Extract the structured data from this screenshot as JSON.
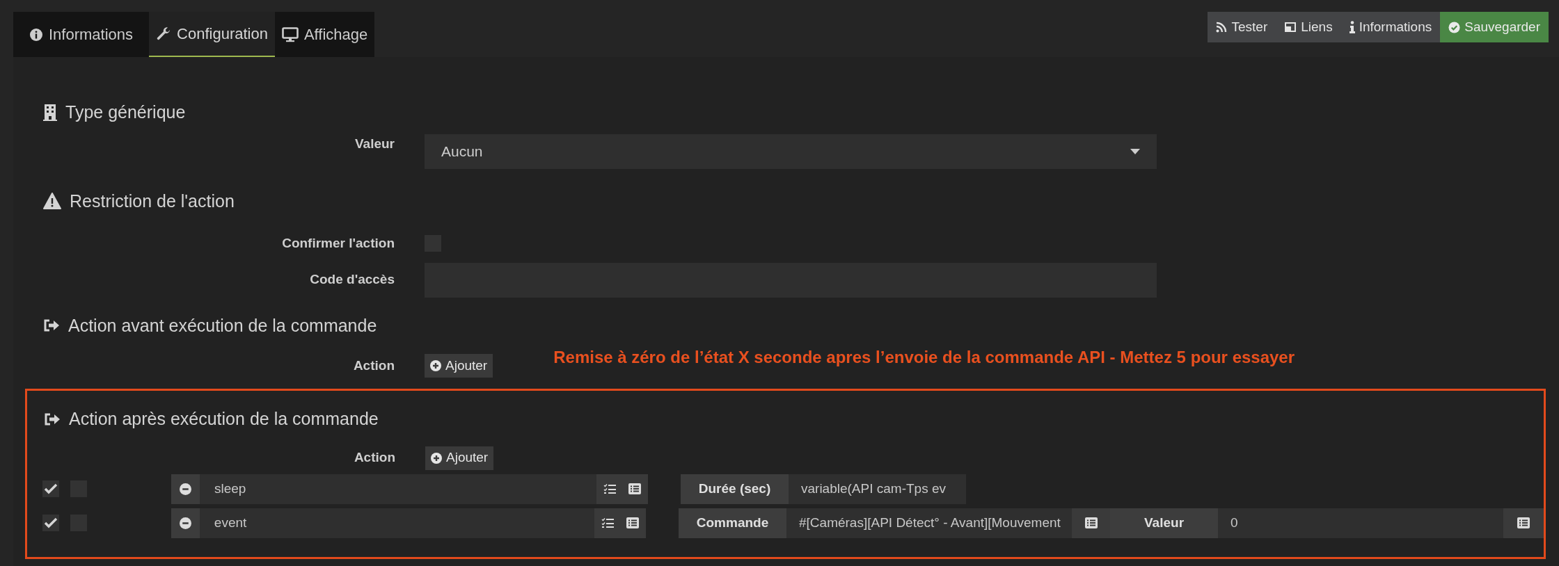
{
  "tabs": [
    {
      "label": "Informations",
      "selected": false
    },
    {
      "label": "Configuration",
      "selected": true
    },
    {
      "label": "Affichage",
      "selected": false
    }
  ],
  "toolbar": [
    {
      "label": "Tester",
      "kind": "default"
    },
    {
      "label": "Liens",
      "kind": "default"
    },
    {
      "label": "Informations",
      "kind": "default"
    },
    {
      "label": "Sauvegarder",
      "kind": "success"
    }
  ],
  "generic_type": {
    "title": "Type générique",
    "label": "Valeur",
    "value": "Aucun"
  },
  "restriction": {
    "title": "Restriction de l'action",
    "confirm_label": "Confirmer l'action",
    "confirm_checked": false,
    "code_label": "Code d'accès"
  },
  "pre_action": {
    "title": "Action avant exécution de la commande",
    "label": "Action",
    "add_button": "Ajouter"
  },
  "annotation": "Remise à zéro de l’état X seconde apres l’envoie de la commande API - Mettez 5 pour essayer",
  "post_action": {
    "title": "Action après exécution de la commande",
    "label": "Action",
    "add_button": "Ajouter",
    "rows": [
      {
        "enabled": true,
        "background": false,
        "command": "sleep",
        "options": [
          {
            "label": "Durée (sec)",
            "value": "variable(API cam-Tps ev",
            "picker": false
          }
        ]
      },
      {
        "enabled": true,
        "background": false,
        "command": "event",
        "options": [
          {
            "label": "Commande",
            "value": "#[Caméras][API Détect° - Avant][Mouvement",
            "picker": true
          },
          {
            "label": "Valeur",
            "value": "0",
            "picker": true
          }
        ]
      }
    ]
  }
}
